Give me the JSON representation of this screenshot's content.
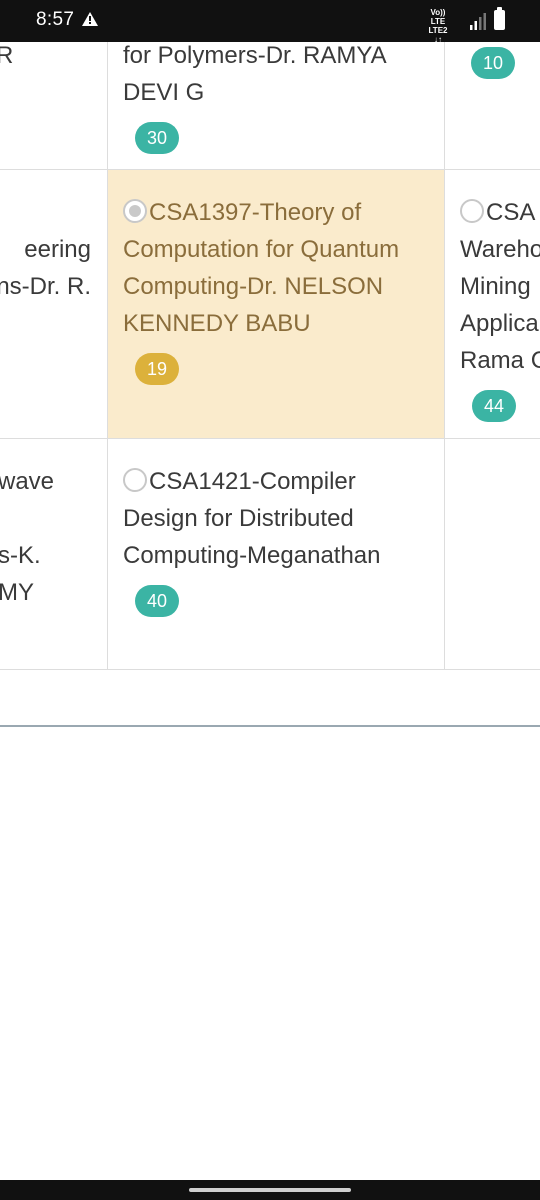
{
  "status_bar": {
    "time": "8:57",
    "network_line1": "Vo)) LTE",
    "network_line2": "LTE2 ↓↑"
  },
  "table": {
    "row1": {
      "left_text": "R",
      "mid_text_line1": "for Polymers-Dr. RAMYA",
      "mid_text_line2": "DEVI G",
      "mid_count": "30",
      "right_count": "10"
    },
    "row2": {
      "left_text_line1": "eering",
      "left_text_line2": "ns-Dr. R.",
      "mid_course": "CSA1397-Theory of Computation for Quantum Computing-Dr. NELSON KENNEDY BABU",
      "mid_line1": "CSA1397-Theory of",
      "mid_line2": "Computation for Quantum",
      "mid_line3": "Computing-Dr. NELSON",
      "mid_line4": "KENNEDY BABU",
      "mid_count": "19",
      "mid_selected": true,
      "right_line1": "CSA",
      "right_line2": "Wareho",
      "right_line3": "Mining",
      "right_line4": "Applica",
      "right_line5": "Rama C",
      "right_count": "44"
    },
    "row3": {
      "left_line1": "wave",
      "left_line2": "s-K.",
      "left_line3": "MY",
      "mid_line1": "CSA1421-Compiler",
      "mid_line2": "Design for Distributed",
      "mid_line3": "Computing-Meganathan",
      "mid_count": "40"
    }
  },
  "colors": {
    "badge_default": "#3bb4a4",
    "badge_selected": "#dcb13b",
    "highlight_bg": "#faebcc",
    "highlight_text": "#8a6d3b"
  }
}
